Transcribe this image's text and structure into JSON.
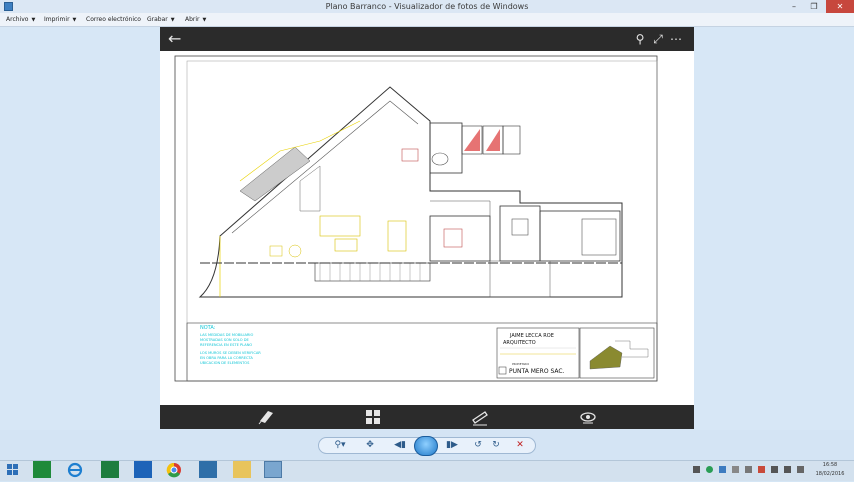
{
  "window": {
    "title": "Plano Barranco - Visualizador de fotos de Windows"
  },
  "menu": {
    "archivo": "Archivo",
    "imprimir": "Imprimir",
    "correo": "Correo electrónico",
    "grabar": "Grabar",
    "abrir": "Abrir"
  },
  "drawing": {
    "notes_heading": "NOTA:",
    "notes_lines": [
      "LAS MEDIDAS DE MOBILIARIO",
      "MOSTRADAS SON SOLO DE",
      "REFERENCIA EN ESTE PLANO",
      "",
      "LOS MUROS SE DEBEN VERIFICAR",
      "EN OBRA PARA LA CORRECTA",
      "UBICACION DE ELEMENTOS"
    ],
    "architect_name": "JAIME LECCA ROE",
    "architect_title": "ARQUITECTO",
    "client_label": "PROPIETARIO",
    "client_name": "PUNTA MERO SAC."
  },
  "taskbar": {
    "time": "16:58",
    "date": "18/02/2016"
  }
}
